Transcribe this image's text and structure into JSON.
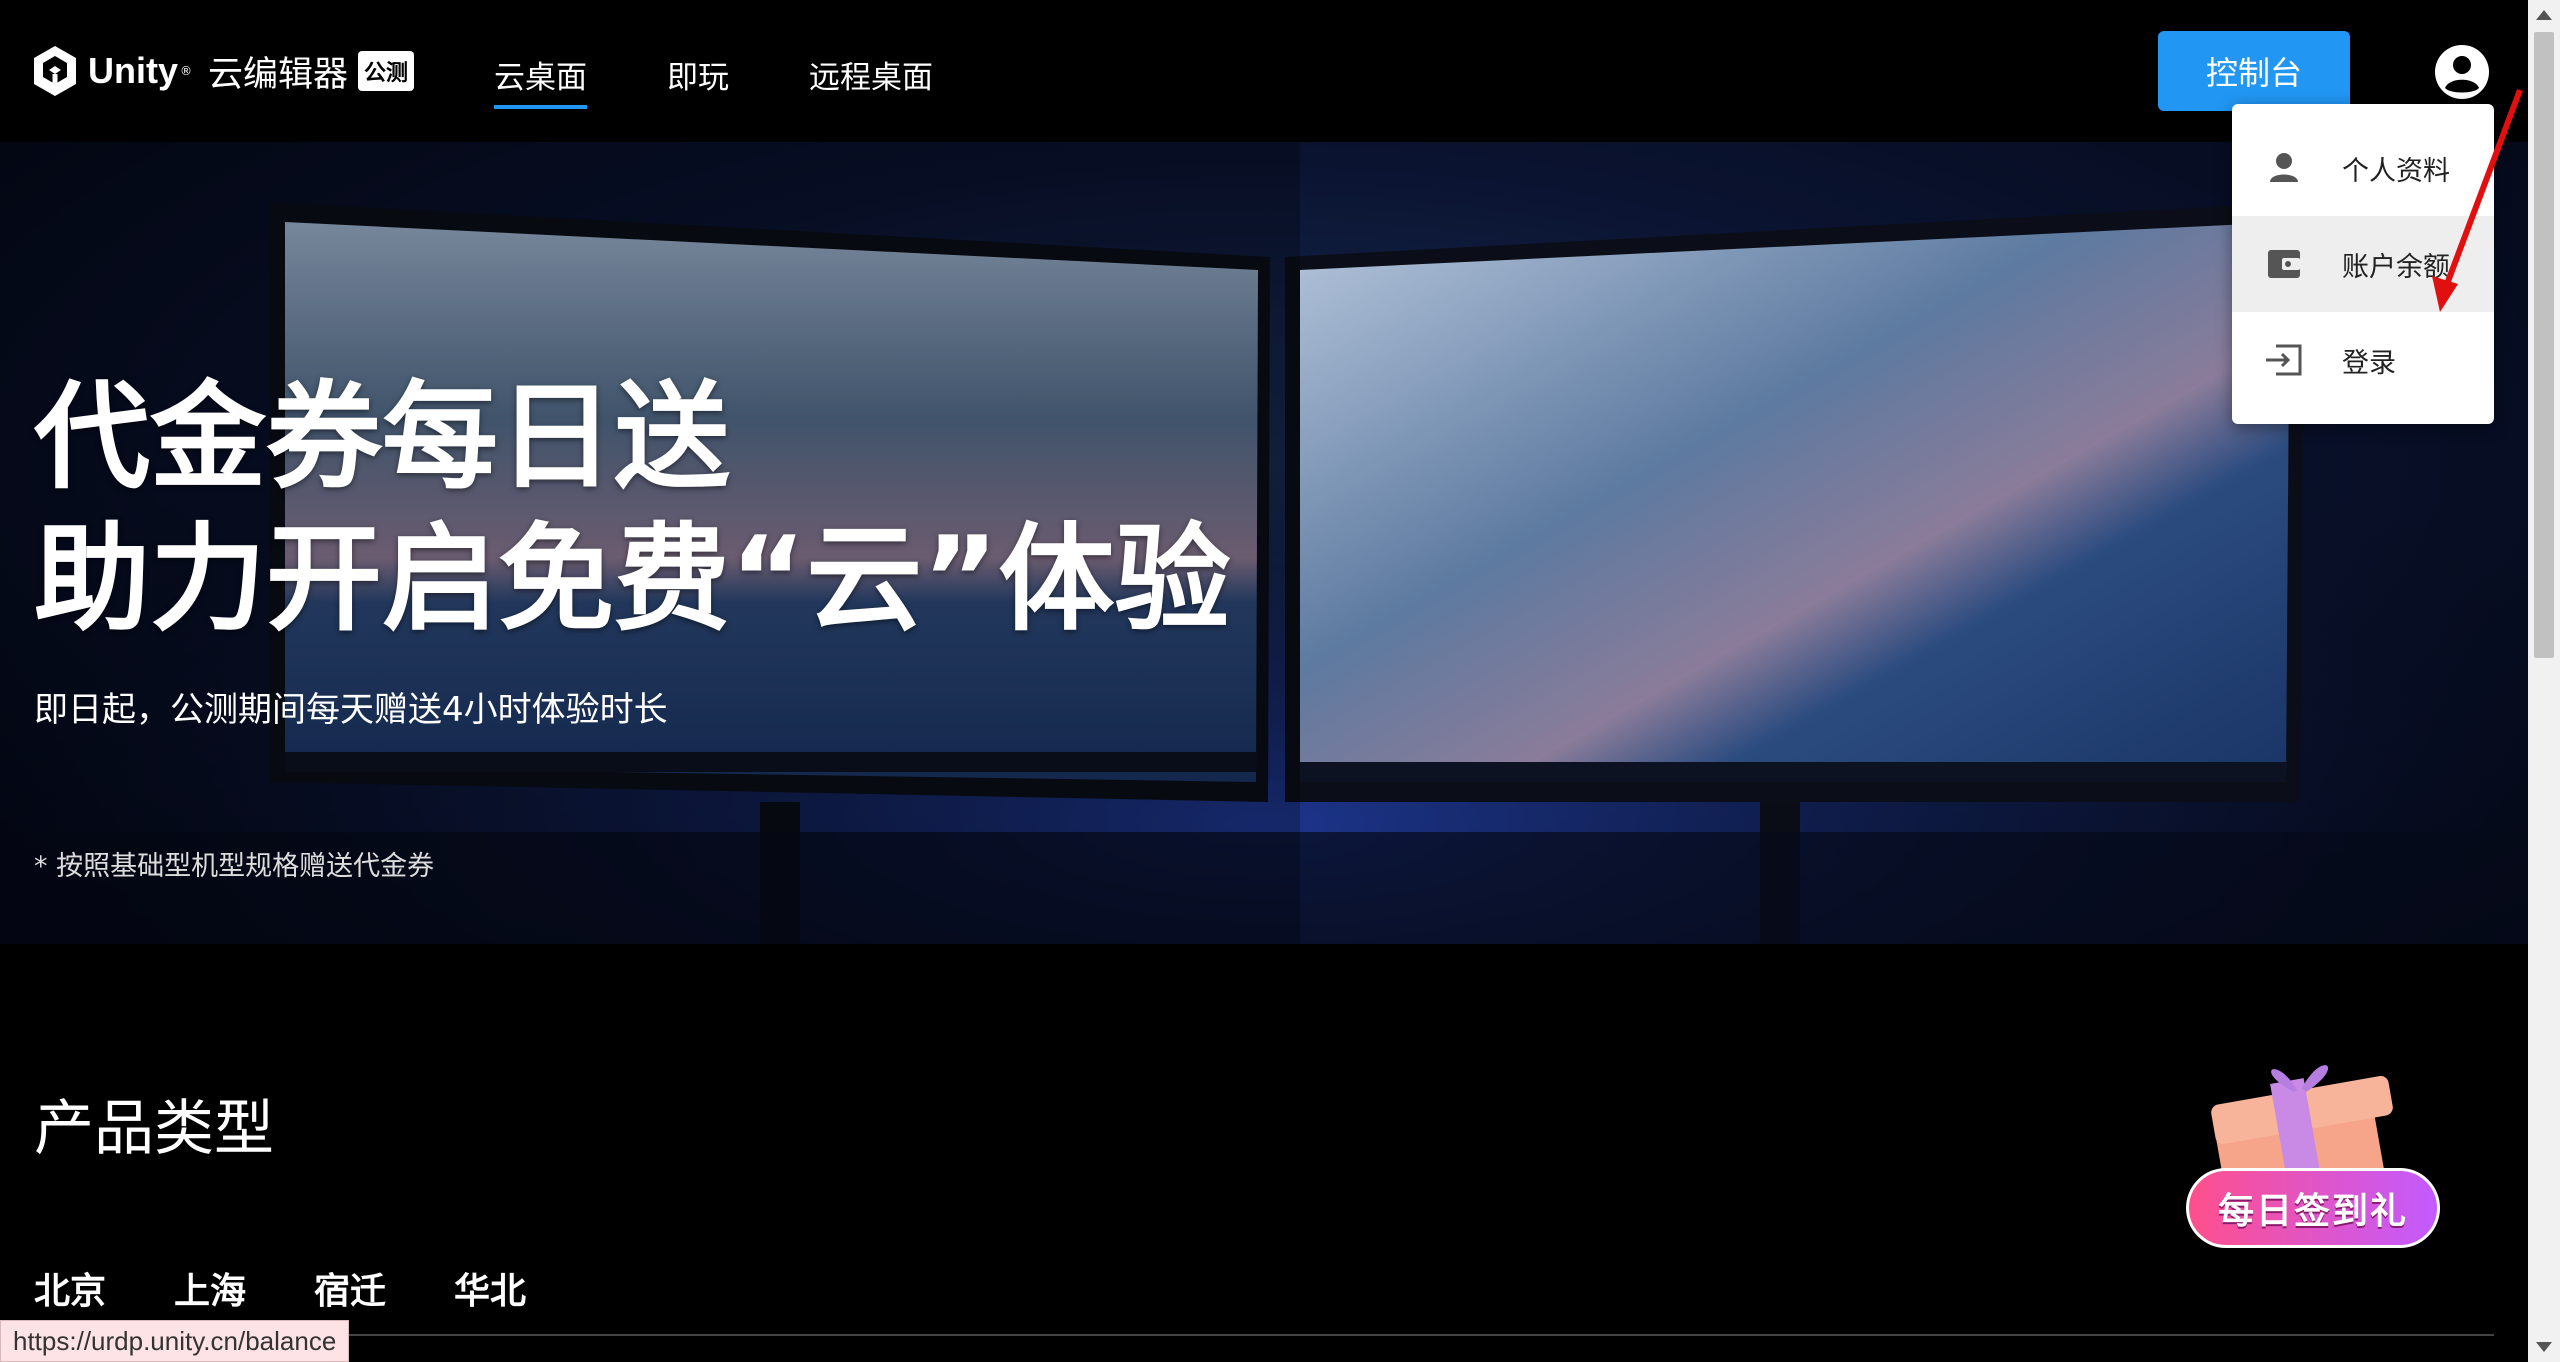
{
  "header": {
    "logo_text": "Unity",
    "logo_reg": "®",
    "product_name": "云编辑器",
    "beta_badge": "公测",
    "nav": [
      {
        "label": "云桌面",
        "active": true
      },
      {
        "label": "即玩",
        "active": false
      },
      {
        "label": "远程桌面",
        "active": false
      }
    ],
    "console_button": "控制台",
    "avatar_icon": "user-circle-icon"
  },
  "hero": {
    "title_line1": "代金券每日送",
    "title_line2": "助力开启免费“云”体验",
    "subtitle": "即日起，公测期间每天赠送4小时体验时长",
    "note": "* 按照基础型机型规格赠送代金券"
  },
  "products": {
    "section_title": "产品类型",
    "regions": [
      "北京",
      "上海",
      "宿迁",
      "华北"
    ]
  },
  "gift_badge": {
    "label": "每日签到礼"
  },
  "user_menu": {
    "items": [
      {
        "label": "个人资料",
        "icon": "person-icon"
      },
      {
        "label": "账户余额",
        "icon": "wallet-icon"
      },
      {
        "label": "登录",
        "icon": "login-icon"
      }
    ]
  },
  "status_bar": {
    "url": "https://urdp.unity.cn/balance"
  },
  "colors": {
    "accent": "#2196f3",
    "annotation": "#e01010"
  }
}
